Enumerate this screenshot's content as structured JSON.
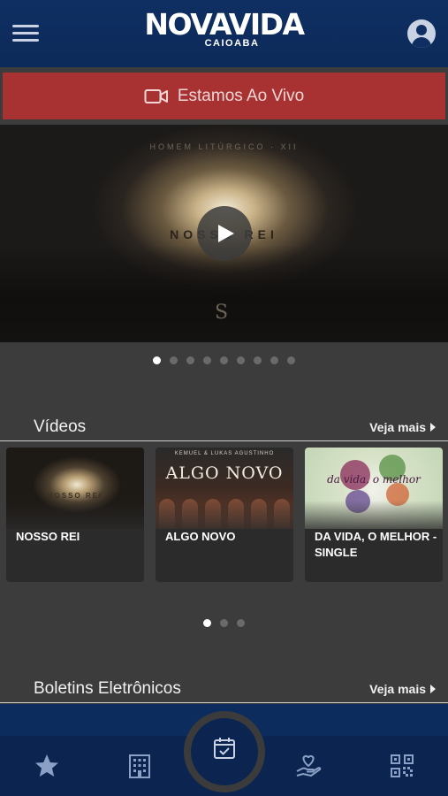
{
  "header": {
    "logo_main": "NOVAVIDA",
    "logo_sub": "CAIOABA"
  },
  "live_banner": {
    "label": "Estamos Ao Vivo",
    "icon": "video-camera-icon"
  },
  "hero": {
    "top_text": "HOMEM LITÚRGICO · XII",
    "title": "NOSSO REI",
    "mark": "S",
    "slides_total": 9,
    "active_slide": 1
  },
  "videos": {
    "title": "Vídeos",
    "see_more": "Veja mais",
    "items": [
      {
        "label": "NOSSO REI",
        "thumb_text": "NOSSO REI"
      },
      {
        "label": "ALGO NOVO",
        "thumb_top": "KEMUEL & LUKAS AGUSTINHO",
        "thumb_text": "ALGO NOVO"
      },
      {
        "label": "DA VIDA, O MELHOR - SINGLE",
        "thumb_text": "da vida, o melhor"
      }
    ],
    "pages_total": 3,
    "active_page": 1
  },
  "bulletins": {
    "title": "Boletins Eletrônicos",
    "see_more": "Veja mais"
  },
  "bottom_nav": [
    {
      "name": "favorites",
      "icon": "star-icon"
    },
    {
      "name": "church",
      "icon": "building-icon"
    },
    {
      "name": "events",
      "icon": "calendar-check-icon"
    },
    {
      "name": "donate",
      "icon": "hand-heart-icon"
    },
    {
      "name": "qr",
      "icon": "qr-code-icon"
    }
  ],
  "colors": {
    "header": "#0f2f63",
    "live_banner": "#a83232",
    "background": "#3c3c3c",
    "nav": "#0b2550"
  }
}
